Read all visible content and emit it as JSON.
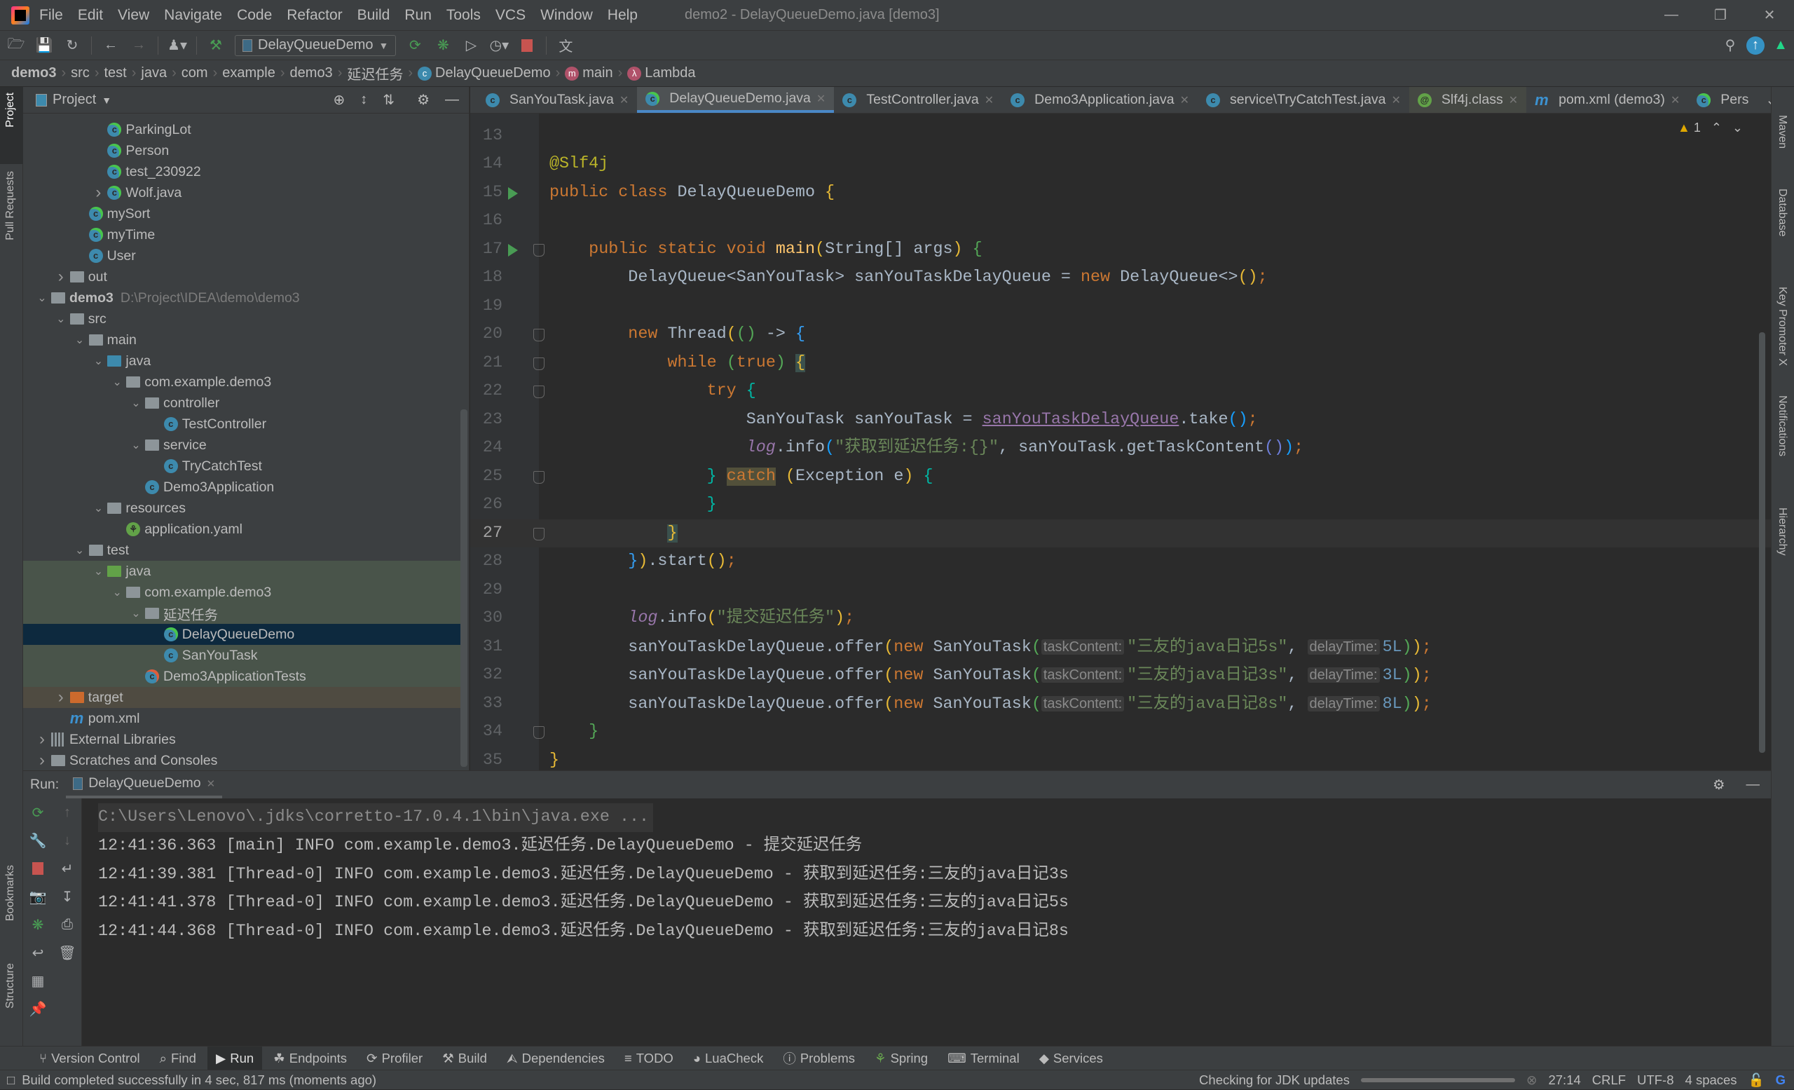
{
  "window": {
    "title": "demo2 - DelayQueueDemo.java [demo3]"
  },
  "menu": [
    "File",
    "Edit",
    "View",
    "Navigate",
    "Code",
    "Refactor",
    "Build",
    "Run",
    "Tools",
    "VCS",
    "Window",
    "Help"
  ],
  "toolbar": {
    "run_config": "DelayQueueDemo"
  },
  "breadcrumb": [
    "demo3",
    "src",
    "test",
    "java",
    "com",
    "example",
    "demo3",
    "延迟任务",
    "DelayQueueDemo",
    "main",
    "Lambda"
  ],
  "left_strip": {
    "project": "Project",
    "pull_requests": "Pull Requests",
    "bookmarks": "Bookmarks",
    "structure": "Structure"
  },
  "right_strip": {
    "maven": "Maven",
    "database": "Database",
    "key_promoter": "Key Promoter X",
    "notifications": "Notifications",
    "hierarchy": "Hierarchy"
  },
  "project": {
    "title": "Project",
    "tree": [
      {
        "label": "ParkingLot",
        "level": 3,
        "icon": "class-run"
      },
      {
        "label": "Person",
        "level": 3,
        "icon": "class-run"
      },
      {
        "label": "test_230922",
        "level": 3,
        "icon": "class-run"
      },
      {
        "label": "Wolf.java",
        "level": 3,
        "icon": "class-run",
        "arrow": "collapsed"
      },
      {
        "label": "mySort",
        "level": 2,
        "icon": "class-run"
      },
      {
        "label": "myTime",
        "level": 2,
        "icon": "class-run"
      },
      {
        "label": "User",
        "level": 2,
        "icon": "class"
      },
      {
        "label": "out",
        "level": 1,
        "icon": "folder",
        "arrow": "collapsed"
      },
      {
        "label": "demo3",
        "level": 0,
        "icon": "module",
        "arrow": "expanded",
        "bold": true,
        "path": "D:\\Project\\IDEA\\demo\\demo3"
      },
      {
        "label": "src",
        "level": 1,
        "icon": "folder",
        "arrow": "expanded"
      },
      {
        "label": "main",
        "level": 2,
        "icon": "folder",
        "arrow": "expanded"
      },
      {
        "label": "java",
        "level": 3,
        "icon": "folder-source",
        "arrow": "expanded"
      },
      {
        "label": "com.example.demo3",
        "level": 4,
        "icon": "package",
        "arrow": "expanded"
      },
      {
        "label": "controller",
        "level": 5,
        "icon": "package",
        "arrow": "expanded"
      },
      {
        "label": "TestController",
        "level": 6,
        "icon": "class"
      },
      {
        "label": "service",
        "level": 5,
        "icon": "package",
        "arrow": "expanded"
      },
      {
        "label": "TryCatchTest",
        "level": 6,
        "icon": "class"
      },
      {
        "label": "Demo3Application",
        "level": 5,
        "icon": "spring-class"
      },
      {
        "label": "resources",
        "level": 3,
        "icon": "folder-resources",
        "arrow": "expanded"
      },
      {
        "label": "application.yaml",
        "level": 4,
        "icon": "spring-yaml"
      },
      {
        "label": "test",
        "level": 2,
        "icon": "folder",
        "arrow": "expanded"
      },
      {
        "label": "java",
        "level": 3,
        "icon": "folder-test",
        "arrow": "expanded",
        "highlight": "green"
      },
      {
        "label": "com.example.demo3",
        "level": 4,
        "icon": "package",
        "arrow": "expanded",
        "highlight": "green"
      },
      {
        "label": "延迟任务",
        "level": 5,
        "icon": "package",
        "arrow": "expanded",
        "highlight": "green"
      },
      {
        "label": "DelayQueueDemo",
        "level": 6,
        "icon": "class-run",
        "highlight": "selected"
      },
      {
        "label": "SanYouTask",
        "level": 6,
        "icon": "class",
        "highlight": "green"
      },
      {
        "label": "Demo3ApplicationTests",
        "level": 5,
        "icon": "class-test",
        "highlight": "green"
      },
      {
        "label": "target",
        "level": 1,
        "icon": "folder-excluded",
        "arrow": "collapsed",
        "highlight": "orange"
      },
      {
        "label": "pom.xml",
        "level": 1,
        "icon": "maven"
      },
      {
        "label": "External Libraries",
        "level": 0,
        "icon": "libraries",
        "arrow": "collapsed"
      },
      {
        "label": "Scratches and Consoles",
        "level": 0,
        "icon": "scratches",
        "arrow": "collapsed"
      }
    ]
  },
  "editor": {
    "tabs": [
      {
        "label": "SanYouTask.java",
        "icon": "class"
      },
      {
        "label": "DelayQueueDemo.java",
        "icon": "class-run",
        "active": true
      },
      {
        "label": "TestController.java",
        "icon": "class"
      },
      {
        "label": "Demo3Application.java",
        "icon": "spring-class"
      },
      {
        "label": "service\\TryCatchTest.java",
        "icon": "class"
      },
      {
        "label": "Slf4j.class",
        "icon": "annotation"
      },
      {
        "label": "pom.xml (demo3)",
        "icon": "maven"
      },
      {
        "label": "Pers",
        "icon": "class-run"
      }
    ],
    "warnings": "1",
    "current_line": 27,
    "lines": [
      {
        "n": 13,
        "t": []
      },
      {
        "n": 14,
        "t": [
          [
            "@Slf4j",
            "ann"
          ]
        ]
      },
      {
        "n": 15,
        "run": true,
        "t": [
          [
            "public class ",
            "kw"
          ],
          [
            "DelayQueueDemo ",
            ""
          ],
          [
            "{",
            "b1"
          ]
        ]
      },
      {
        "n": 16,
        "t": []
      },
      {
        "n": 17,
        "run": true,
        "fold": true,
        "t": [
          [
            "    ",
            ""
          ],
          [
            "public static void ",
            "kw"
          ],
          [
            "main",
            "fn"
          ],
          [
            "(",
            "b1"
          ],
          [
            "String[] args",
            ""
          ],
          [
            ")",
            "b1"
          ],
          [
            " ",
            ""
          ],
          [
            "{",
            "b2"
          ]
        ]
      },
      {
        "n": 18,
        "t": [
          [
            "        DelayQueue<SanYouTask> sanYouTaskDelayQueue = ",
            ""
          ],
          [
            "new ",
            "kw"
          ],
          [
            "DelayQueue<>",
            ""
          ],
          [
            "()",
            "b1"
          ],
          [
            ";",
            "kw"
          ]
        ]
      },
      {
        "n": 19,
        "t": []
      },
      {
        "n": 20,
        "fold": true,
        "t": [
          [
            "        ",
            ""
          ],
          [
            "new ",
            "kw"
          ],
          [
            "Thread",
            ""
          ],
          [
            "(",
            "b1"
          ],
          [
            "()",
            "b2"
          ],
          [
            " -> ",
            ""
          ],
          [
            "{",
            "b3"
          ]
        ]
      },
      {
        "n": 21,
        "fold": true,
        "t": [
          [
            "            ",
            ""
          ],
          [
            "while ",
            "kw"
          ],
          [
            "(",
            "b2"
          ],
          [
            "true",
            "kw"
          ],
          [
            ")",
            "b2"
          ],
          [
            " ",
            ""
          ],
          [
            "{",
            "byh"
          ]
        ]
      },
      {
        "n": 22,
        "fold": true,
        "t": [
          [
            "                ",
            ""
          ],
          [
            "try ",
            "kw"
          ],
          [
            "{",
            "bt"
          ]
        ]
      },
      {
        "n": 23,
        "t": [
          [
            "                    SanYouTask sanYouTask = ",
            ""
          ],
          [
            "sanYouTaskDelayQueue",
            "fldu"
          ],
          [
            ".take",
            ""
          ],
          [
            "()",
            "b5"
          ],
          [
            ";",
            "kw"
          ]
        ]
      },
      {
        "n": 24,
        "t": [
          [
            "                    ",
            ""
          ],
          [
            "log",
            "itl"
          ],
          [
            ".info",
            ""
          ],
          [
            "(",
            "b5"
          ],
          [
            "\"获取到延迟任务:{}\"",
            "str"
          ],
          [
            ", sanYouTask.getTaskContent",
            ""
          ],
          [
            "()",
            "b4"
          ],
          [
            ")",
            "b5"
          ],
          [
            ";",
            "kw"
          ]
        ]
      },
      {
        "n": 25,
        "fold": true,
        "t": [
          [
            "                ",
            ""
          ],
          [
            "}",
            "bt"
          ],
          [
            " ",
            ""
          ],
          [
            "catch",
            "kwh"
          ],
          [
            " ",
            ""
          ],
          [
            "(",
            "b1"
          ],
          [
            "Exception e",
            ""
          ],
          [
            ")",
            "b1"
          ],
          [
            " ",
            ""
          ],
          [
            "{",
            "bt"
          ]
        ]
      },
      {
        "n": 26,
        "t": [
          [
            "                ",
            ""
          ],
          [
            "}",
            "bt"
          ]
        ]
      },
      {
        "n": 27,
        "fold": true,
        "t": [
          [
            "            ",
            ""
          ],
          [
            "}",
            "byh"
          ]
        ]
      },
      {
        "n": 28,
        "t": [
          [
            "        ",
            ""
          ],
          [
            "}",
            "b3"
          ],
          [
            ")",
            "b1"
          ],
          [
            ".start",
            ""
          ],
          [
            "()",
            "b1"
          ],
          [
            ";",
            "kw"
          ]
        ]
      },
      {
        "n": 29,
        "t": []
      },
      {
        "n": 30,
        "t": [
          [
            "        ",
            ""
          ],
          [
            "log",
            "itl"
          ],
          [
            ".info",
            ""
          ],
          [
            "(",
            "b1"
          ],
          [
            "\"提交延迟任务\"",
            "str"
          ],
          [
            ")",
            "b1"
          ],
          [
            ";",
            "kw"
          ]
        ]
      },
      {
        "n": 31,
        "t": [
          [
            "        sanYouTaskDelayQueue.offer",
            ""
          ],
          [
            "(",
            "b1"
          ],
          [
            "new ",
            "kw"
          ],
          [
            "SanYouTask",
            ""
          ],
          [
            "(",
            "b2"
          ],
          [
            "taskContent:",
            "hint"
          ],
          [
            "\"三友的java日记5s\"",
            "str"
          ],
          [
            ", ",
            ""
          ],
          [
            "delayTime:",
            "hint"
          ],
          [
            "5L",
            "num"
          ],
          [
            ")",
            "b2"
          ],
          [
            ")",
            "b1"
          ],
          [
            ";",
            "kw"
          ]
        ]
      },
      {
        "n": 32,
        "t": [
          [
            "        sanYouTaskDelayQueue.offer",
            ""
          ],
          [
            "(",
            "b1"
          ],
          [
            "new ",
            "kw"
          ],
          [
            "SanYouTask",
            ""
          ],
          [
            "(",
            "b2"
          ],
          [
            "taskContent:",
            "hint"
          ],
          [
            "\"三友的java日记3s\"",
            "str"
          ],
          [
            ", ",
            ""
          ],
          [
            "delayTime:",
            "hint"
          ],
          [
            "3L",
            "num"
          ],
          [
            ")",
            "b2"
          ],
          [
            ")",
            "b1"
          ],
          [
            ";",
            "kw"
          ]
        ]
      },
      {
        "n": 33,
        "t": [
          [
            "        sanYouTaskDelayQueue.offer",
            ""
          ],
          [
            "(",
            "b1"
          ],
          [
            "new ",
            "kw"
          ],
          [
            "SanYouTask",
            ""
          ],
          [
            "(",
            "b2"
          ],
          [
            "taskContent:",
            "hint"
          ],
          [
            "\"三友的java日记8s\"",
            "str"
          ],
          [
            ", ",
            ""
          ],
          [
            "delayTime:",
            "hint"
          ],
          [
            "8L",
            "num"
          ],
          [
            ")",
            "b2"
          ],
          [
            ")",
            "b1"
          ],
          [
            ";",
            "kw"
          ]
        ]
      },
      {
        "n": 34,
        "fold": true,
        "t": [
          [
            "    ",
            ""
          ],
          [
            "}",
            "b2"
          ]
        ]
      },
      {
        "n": 35,
        "t": [
          [
            "}",
            "b1"
          ]
        ]
      }
    ]
  },
  "run": {
    "label": "Run:",
    "tab": "DelayQueueDemo",
    "console": [
      "C:\\Users\\Lenovo\\.jdks\\corretto-17.0.4.1\\bin\\java.exe ...",
      "12:41:36.363 [main] INFO com.example.demo3.延迟任务.DelayQueueDemo - 提交延迟任务",
      "12:41:39.381 [Thread-0] INFO com.example.demo3.延迟任务.DelayQueueDemo - 获取到延迟任务:三友的java日记3s",
      "12:41:41.378 [Thread-0] INFO com.example.demo3.延迟任务.DelayQueueDemo - 获取到延迟任务:三友的java日记5s",
      "12:41:44.368 [Thread-0] INFO com.example.demo3.延迟任务.DelayQueueDemo - 获取到延迟任务:三友的java日记8s"
    ]
  },
  "bottom_tools": [
    {
      "label": "Version Control",
      "icon": "vcs"
    },
    {
      "label": "Find",
      "icon": "search"
    },
    {
      "label": "Run",
      "icon": "run",
      "active": true
    },
    {
      "label": "Endpoints",
      "icon": "endpoints"
    },
    {
      "label": "Profiler",
      "icon": "profiler"
    },
    {
      "label": "Build",
      "icon": "hammer"
    },
    {
      "label": "Dependencies",
      "icon": "dependencies"
    },
    {
      "label": "TODO",
      "icon": "list"
    },
    {
      "label": "LuaCheck",
      "icon": "luacheck"
    },
    {
      "label": "Problems",
      "icon": "problems"
    },
    {
      "label": "Spring",
      "icon": "spring"
    },
    {
      "label": "Terminal",
      "icon": "terminal"
    },
    {
      "label": "Services",
      "icon": "services"
    }
  ],
  "status": {
    "message": "Build completed successfully in 4 sec, 817 ms (moments ago)",
    "task": "Checking for JDK updates",
    "position": "27:14",
    "line_ending": "CRLF",
    "encoding": "UTF-8",
    "indent": "4 spaces"
  }
}
